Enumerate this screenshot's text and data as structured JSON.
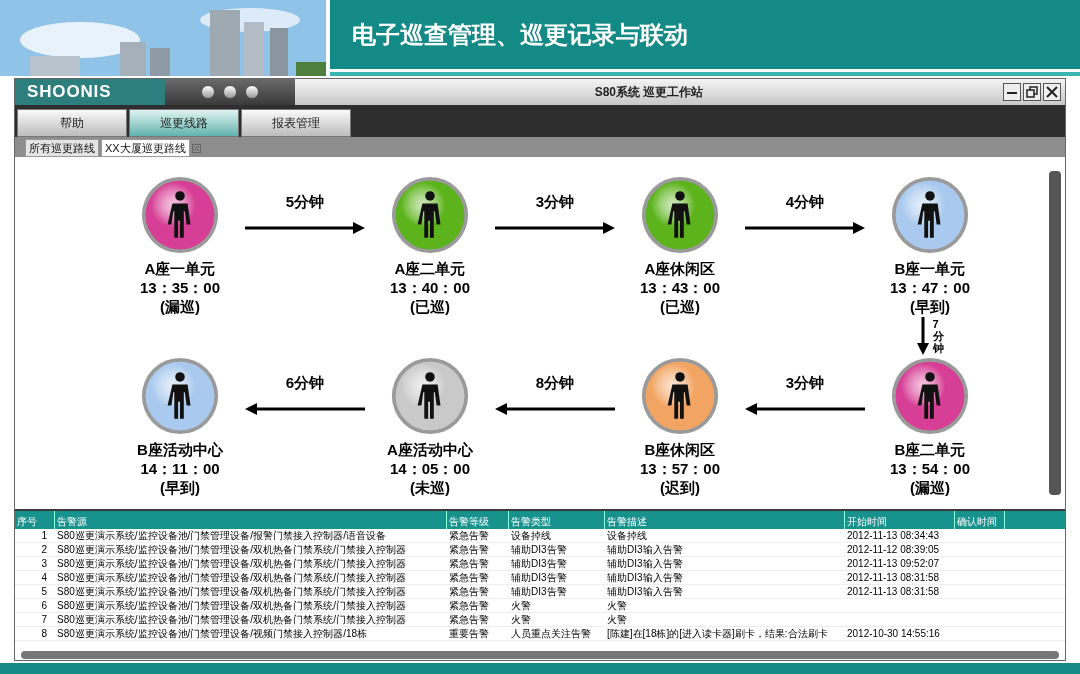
{
  "slide_title": "电子巡查管理、巡更记录与联动",
  "window": {
    "logo": "SHOONIS",
    "title": "S80系统 巡更工作站"
  },
  "menu": [
    {
      "label": "帮助",
      "selected": false
    },
    {
      "label": "巡更线路",
      "selected": true
    },
    {
      "label": "报表管理",
      "selected": false
    }
  ],
  "tabs": [
    {
      "label": "所有巡更路线",
      "selected": false,
      "closable": false
    },
    {
      "label": "XX大厦巡更路线",
      "selected": true,
      "closable": true
    }
  ],
  "top_row": {
    "checkpoints": [
      {
        "name": "A座一单元",
        "time": "13：35：00",
        "status": "(漏巡)",
        "color": "#d63f95"
      },
      {
        "name": "A座二单元",
        "time": "13：40：00",
        "status": "(已巡)",
        "color": "#5cb31c"
      },
      {
        "name": "A座休闲区",
        "time": "13：43：00",
        "status": "(已巡)",
        "color": "#5cb31c"
      },
      {
        "name": "B座一单元",
        "time": "13：47：00",
        "status": "(早到)",
        "color": "#a9c9ee"
      }
    ],
    "legs": [
      "5分钟",
      "3分钟",
      "4分钟"
    ]
  },
  "down_leg": "7分钟",
  "bottom_row": {
    "checkpoints": [
      {
        "name": "B座活动中心",
        "time": "14：11：00",
        "status": "(早到)",
        "color": "#a9c9ee"
      },
      {
        "name": "A座活动中心",
        "time": "14：05：00",
        "status": "(未巡)",
        "color": "#c9c9c9"
      },
      {
        "name": "B座休闲区",
        "time": "13：57：00",
        "status": "(迟到)",
        "color": "#f2a462"
      },
      {
        "name": "B座二单元",
        "time": "13：54：00",
        "status": "(漏巡)",
        "color": "#d63f95"
      }
    ],
    "legs": [
      "6分钟",
      "8分钟",
      "3分钟"
    ]
  },
  "table": {
    "columns": [
      "序号",
      "告警源",
      "告警等级",
      "告警类型",
      "告警描述",
      "开始时间",
      "确认时间"
    ],
    "rows": [
      [
        "1",
        "S80巡更演示系统/监控设备池/门禁管理设备/报警门禁接入控制器/语音设备",
        "紧急告警",
        "设备掉线",
        "设备掉线",
        "2012-11-13 08:34:43"
      ],
      [
        "2",
        "S80巡更演示系统/监控设备池/门禁管理设备/双机热备门禁系统/门禁接入控制器",
        "紧急告警",
        "辅助DI3告警",
        "辅助DI3输入告警",
        "2012-11-12 08:39:05"
      ],
      [
        "3",
        "S80巡更演示系统/监控设备池/门禁管理设备/双机热备门禁系统/门禁接入控制器",
        "紧急告警",
        "辅助DI3告警",
        "辅助DI3输入告警",
        "2012-11-13 09:52:07"
      ],
      [
        "4",
        "S80巡更演示系统/监控设备池/门禁管理设备/双机热备门禁系统/门禁接入控制器",
        "紧急告警",
        "辅助DI3告警",
        "辅助DI3输入告警",
        "2012-11-13 08:31:58"
      ],
      [
        "5",
        "S80巡更演示系统/监控设备池/门禁管理设备/双机热备门禁系统/门禁接入控制器",
        "紧急告警",
        "辅助DI3告警",
        "辅助DI3输入告警",
        "2012-11-13 08:31:58"
      ],
      [
        "6",
        "S80巡更演示系统/监控设备池/门禁管理设备/双机热备门禁系统/门禁接入控制器",
        "紧急告警",
        "火警",
        "火警"
      ],
      [
        "7",
        "S80巡更演示系统/监控设备池/门禁管理设备/双机热备门禁系统/门禁接入控制器",
        "紧急告警",
        "火警",
        "火警"
      ],
      [
        "8",
        "S80巡更演示系统/监控设备池/门禁管理设备/视频门禁接入控制器/18栋",
        "重要告警",
        "人员重点关注告警",
        "[陈建]在[18栋]的[进入读卡器]刷卡，结果:合法刷卡",
        "2012-10-30 14:55:16"
      ]
    ]
  }
}
